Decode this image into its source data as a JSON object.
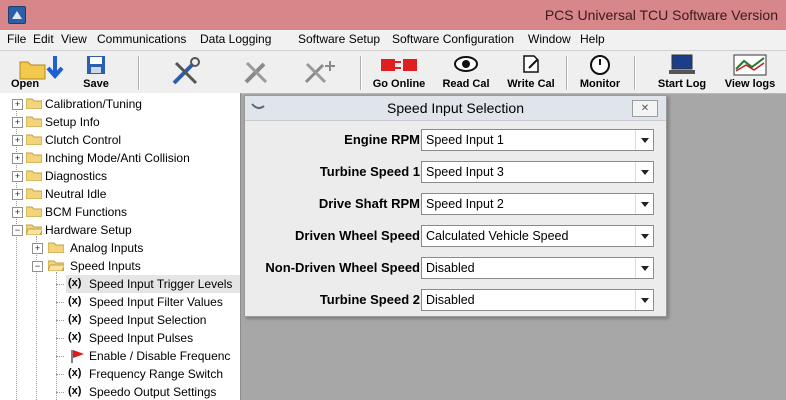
{
  "window": {
    "title": "PCS Universal TCU Software Version"
  },
  "menu": [
    "File",
    "Edit",
    "View",
    "Communications",
    "Data Logging",
    "Software Setup",
    "Software Configuration",
    "Window",
    "Help"
  ],
  "toolbar": {
    "open": "Open",
    "save": "Save",
    "go_online": "Go Online",
    "read_cal": "Read Cal",
    "write_cal": "Write Cal",
    "monitor": "Monitor",
    "start_log": "Start Log",
    "view_logs": "View logs"
  },
  "tree": {
    "top": [
      "Calibration/Tuning",
      "Setup Info",
      "Clutch Control",
      "Inching Mode/Anti Collision",
      "Diagnostics",
      "Neutral Idle",
      "BCM Functions",
      "Hardware Setup"
    ],
    "hardware": [
      "Analog Inputs",
      "Speed Inputs"
    ],
    "speed_children": [
      {
        "prefix": "(x)",
        "label": "Speed Input Trigger Levels"
      },
      {
        "prefix": "(x)",
        "label": "Speed Input Filter Values"
      },
      {
        "prefix": "(x)",
        "label": "Speed Input Selection"
      },
      {
        "prefix": "(x)",
        "label": "Speed Input Pulses"
      },
      {
        "prefix": "",
        "label": "Enable / Disable Frequenc"
      },
      {
        "prefix": "(x)",
        "label": "Frequency Range Switch"
      },
      {
        "prefix": "(x)",
        "label": "Speedo Output Settings"
      }
    ]
  },
  "dialog": {
    "title": "Speed Input Selection",
    "close": "✕",
    "rows": [
      {
        "label": "Engine RPM",
        "value": "Speed Input 1"
      },
      {
        "label": "Turbine Speed 1",
        "value": "Speed Input 3"
      },
      {
        "label": "Drive Shaft RPM",
        "value": "Speed Input 2"
      },
      {
        "label": "Driven Wheel Speed",
        "value": "Calculated Vehicle Speed"
      },
      {
        "label": "Non-Driven Wheel Speed",
        "value": "Disabled"
      },
      {
        "label": "Turbine Speed 2",
        "value": "Disabled"
      }
    ]
  }
}
